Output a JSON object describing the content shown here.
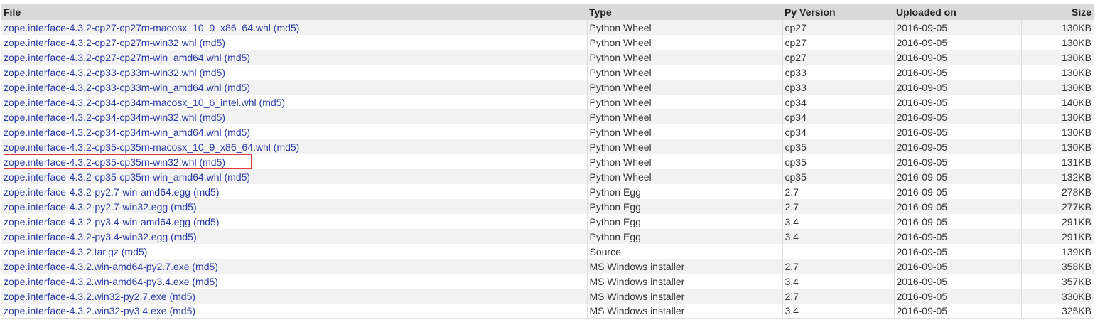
{
  "table": {
    "headers": {
      "file": "File",
      "type": "Type",
      "py_version": "Py Version",
      "uploaded_on": "Uploaded on",
      "size": "Size"
    },
    "md5_label": "(md5)",
    "highlighted_row_index": 9,
    "highlight_color": "#e03a3a",
    "link_color": "#2a3aa4",
    "rows": [
      {
        "file": "zope.interface-4.3.2-cp27-cp27m-macosx_10_9_x86_64.whl",
        "md5": "(md5)",
        "type": "Python Wheel",
        "py": "cp27",
        "uploaded": "2016-09-05",
        "size": "130KB"
      },
      {
        "file": "zope.interface-4.3.2-cp27-cp27m-win32.whl",
        "md5": "(md5)",
        "type": "Python Wheel",
        "py": "cp27",
        "uploaded": "2016-09-05",
        "size": "130KB"
      },
      {
        "file": "zope.interface-4.3.2-cp27-cp27m-win_amd64.whl",
        "md5": "(md5)",
        "type": "Python Wheel",
        "py": "cp27",
        "uploaded": "2016-09-05",
        "size": "130KB"
      },
      {
        "file": "zope.interface-4.3.2-cp33-cp33m-win32.whl",
        "md5": "(md5)",
        "type": "Python Wheel",
        "py": "cp33",
        "uploaded": "2016-09-05",
        "size": "130KB"
      },
      {
        "file": "zope.interface-4.3.2-cp33-cp33m-win_amd64.whl",
        "md5": "(md5)",
        "type": "Python Wheel",
        "py": "cp33",
        "uploaded": "2016-09-05",
        "size": "130KB"
      },
      {
        "file": "zope.interface-4.3.2-cp34-cp34m-macosx_10_6_intel.whl",
        "md5": "(md5)",
        "type": "Python Wheel",
        "py": "cp34",
        "uploaded": "2016-09-05",
        "size": "140KB"
      },
      {
        "file": "zope.interface-4.3.2-cp34-cp34m-win32.whl",
        "md5": "(md5)",
        "type": "Python Wheel",
        "py": "cp34",
        "uploaded": "2016-09-05",
        "size": "130KB"
      },
      {
        "file": "zope.interface-4.3.2-cp34-cp34m-win_amd64.whl",
        "md5": "(md5)",
        "type": "Python Wheel",
        "py": "cp34",
        "uploaded": "2016-09-05",
        "size": "130KB"
      },
      {
        "file": "zope.interface-4.3.2-cp35-cp35m-macosx_10_9_x86_64.whl",
        "md5": "(md5)",
        "type": "Python Wheel",
        "py": "cp35",
        "uploaded": "2016-09-05",
        "size": "130KB"
      },
      {
        "file": "zope.interface-4.3.2-cp35-cp35m-win32.whl",
        "md5": "(md5)",
        "type": "Python Wheel",
        "py": "cp35",
        "uploaded": "2016-09-05",
        "size": "131KB"
      },
      {
        "file": "zope.interface-4.3.2-cp35-cp35m-win_amd64.whl",
        "md5": "(md5)",
        "type": "Python Wheel",
        "py": "cp35",
        "uploaded": "2016-09-05",
        "size": "132KB"
      },
      {
        "file": "zope.interface-4.3.2-py2.7-win-amd64.egg",
        "md5": "(md5)",
        "type": "Python Egg",
        "py": "2.7",
        "uploaded": "2016-09-05",
        "size": "278KB"
      },
      {
        "file": "zope.interface-4.3.2-py2.7-win32.egg",
        "md5": "(md5)",
        "type": "Python Egg",
        "py": "2.7",
        "uploaded": "2016-09-05",
        "size": "277KB"
      },
      {
        "file": "zope.interface-4.3.2-py3.4-win-amd64.egg",
        "md5": "(md5)",
        "type": "Python Egg",
        "py": "3.4",
        "uploaded": "2016-09-05",
        "size": "291KB"
      },
      {
        "file": "zope.interface-4.3.2-py3.4-win32.egg",
        "md5": "(md5)",
        "type": "Python Egg",
        "py": "3.4",
        "uploaded": "2016-09-05",
        "size": "291KB"
      },
      {
        "file": "zope.interface-4.3.2.tar.gz",
        "md5": "(md5)",
        "type": "Source",
        "py": "",
        "uploaded": "2016-09-05",
        "size": "139KB"
      },
      {
        "file": "zope.interface-4.3.2.win-amd64-py2.7.exe",
        "md5": "(md5)",
        "type": "MS Windows installer",
        "py": "2.7",
        "uploaded": "2016-09-05",
        "size": "358KB"
      },
      {
        "file": "zope.interface-4.3.2.win-amd64-py3.4.exe",
        "md5": "(md5)",
        "type": "MS Windows installer",
        "py": "3.4",
        "uploaded": "2016-09-05",
        "size": "357KB"
      },
      {
        "file": "zope.interface-4.3.2.win32-py2.7.exe",
        "md5": "(md5)",
        "type": "MS Windows installer",
        "py": "2.7",
        "uploaded": "2016-09-05",
        "size": "330KB"
      },
      {
        "file": "zope.interface-4.3.2.win32-py3.4.exe",
        "md5": "(md5)",
        "type": "MS Windows installer",
        "py": "3.4",
        "uploaded": "2016-09-05",
        "size": "325KB"
      }
    ]
  }
}
